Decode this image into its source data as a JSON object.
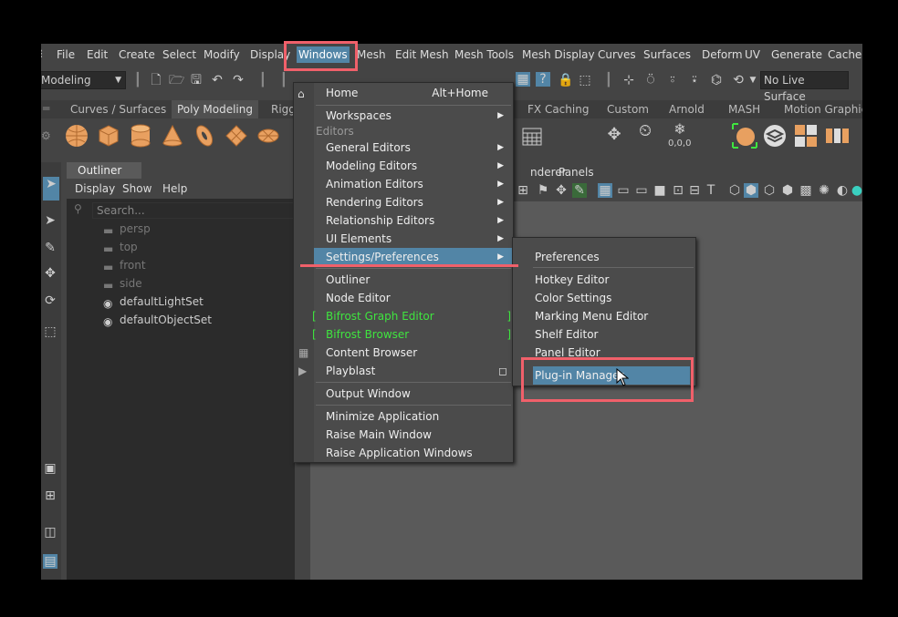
{
  "menubar": {
    "items": [
      "File",
      "Edit",
      "Create",
      "Select",
      "Modify",
      "Display",
      "Windows",
      "Mesh",
      "Edit Mesh",
      "Mesh Tools",
      "Mesh Display",
      "Curves",
      "Surfaces",
      "Deform",
      "UV",
      "Generate",
      "Cache"
    ]
  },
  "statusline": {
    "mode": "Modeling",
    "live_surface": "No Live Surface"
  },
  "shelf": {
    "tabs": [
      "Curves / Surfaces",
      "Poly Modeling",
      "Rigg",
      "FX Caching",
      "Custom",
      "Arnold",
      "MASH",
      "Motion Graphics"
    ],
    "active_tab": "Poly Modeling",
    "snap_label": "0,0,0"
  },
  "outliner": {
    "title": "Outliner",
    "menu": [
      "Display",
      "Show",
      "Help"
    ],
    "search_placeholder": "Search...",
    "items": [
      "persp",
      "top",
      "front",
      "side",
      "defaultLightSet",
      "defaultObjectSet"
    ]
  },
  "panel_menu": {
    "items": [
      "nderer",
      "Panels"
    ]
  },
  "windows_menu": {
    "home": "Home",
    "home_shortcut": "Alt+Home",
    "workspaces": "Workspaces",
    "editors_header": "Editors",
    "items": [
      "General Editors",
      "Modeling Editors",
      "Animation Editors",
      "Rendering Editors",
      "Relationship Editors",
      "UI Elements",
      "Settings/Preferences"
    ],
    "outliner": "Outliner",
    "node_editor": "Node Editor",
    "bifrost_graph": "Bifrost Graph Editor",
    "bifrost_browser": "Bifrost Browser",
    "content_browser": "Content Browser",
    "playblast": "Playblast",
    "output_window": "Output Window",
    "minimize": "Minimize Application",
    "raise_main": "Raise Main Window",
    "raise_app": "Raise Application Windows"
  },
  "prefs_submenu": {
    "preferences": "Preferences",
    "items": [
      "Hotkey Editor",
      "Color Settings",
      "Marking Menu Editor",
      "Shelf Editor",
      "Panel Editor"
    ],
    "plugin_manager": "Plug-in Manager"
  },
  "colors": {
    "highlight": "#5285a6",
    "annotation": "#f0606a",
    "bifrost_green": "#3fe53f"
  }
}
